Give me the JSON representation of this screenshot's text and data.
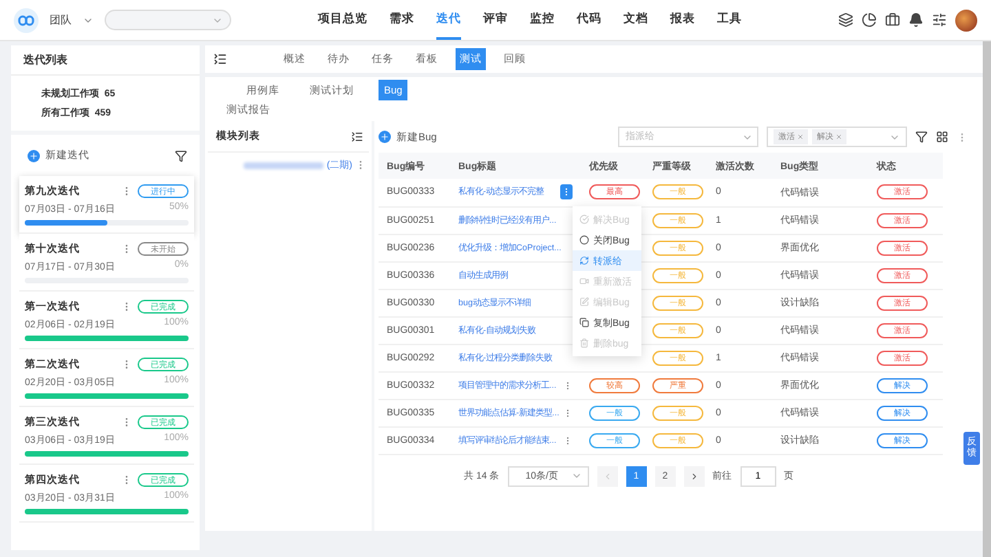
{
  "header": {
    "team": "团队",
    "nav": [
      {
        "label": "项目总览",
        "selected": false
      },
      {
        "label": "需求",
        "selected": false
      },
      {
        "label": "迭代",
        "selected": true
      },
      {
        "label": "评审",
        "selected": false
      },
      {
        "label": "监控",
        "selected": false
      },
      {
        "label": "代码",
        "selected": false
      },
      {
        "label": "文档",
        "selected": false
      },
      {
        "label": "报表",
        "selected": false
      },
      {
        "label": "工具",
        "selected": false
      }
    ]
  },
  "sidebar": {
    "title": "迭代列表",
    "stats": [
      {
        "label": "未规划工作项",
        "count": "65"
      },
      {
        "label": "所有工作项",
        "count": "459"
      }
    ],
    "new_button": "新建迭代",
    "iterations": [
      {
        "name": "第九次迭代",
        "dates": "07月03日 - 07月16日",
        "percent": "50%",
        "level": 0.5,
        "status": "进行中",
        "color": "#2f9bf0",
        "selected": true
      },
      {
        "name": "第十次迭代",
        "dates": "07月17日 - 07月30日",
        "percent": "0%",
        "level": 0,
        "status": "未开始",
        "color": "#888888",
        "selected": false
      },
      {
        "name": "第一次迭代",
        "dates": "02月06日 - 02月19日",
        "percent": "100%",
        "level": 1,
        "status": "已完成",
        "color": "#19c88a",
        "selected": false
      },
      {
        "name": "第二次迭代",
        "dates": "02月20日 - 03月05日",
        "percent": "100%",
        "level": 1,
        "status": "已完成",
        "color": "#19c88a",
        "selected": false
      },
      {
        "name": "第三次迭代",
        "dates": "03月06日 - 03月19日",
        "percent": "100%",
        "level": 1,
        "status": "已完成",
        "color": "#19c88a",
        "selected": false
      },
      {
        "name": "第四次迭代",
        "dates": "03月20日 - 03月31日",
        "percent": "100%",
        "level": 1,
        "status": "已完成",
        "color": "#19c88a",
        "selected": false
      }
    ]
  },
  "view_tabs": [
    {
      "label": "概述",
      "selected": false
    },
    {
      "label": "待办",
      "selected": false
    },
    {
      "label": "任务",
      "selected": false
    },
    {
      "label": "看板",
      "selected": false
    },
    {
      "label": "测试",
      "selected": true
    },
    {
      "label": "回顾",
      "selected": false
    }
  ],
  "test_tabs": [
    {
      "label": "用例库",
      "selected": false
    },
    {
      "label": "测试计划",
      "selected": false
    },
    {
      "label": "Bug",
      "selected": true
    },
    {
      "label": "测试报告",
      "selected": false
    }
  ],
  "modules": {
    "title": "模块列表",
    "items": [
      "(二期)"
    ]
  },
  "toolbar": {
    "new_button": "新建Bug",
    "assignee": {
      "placeholder": "指派给"
    },
    "status_filter": [
      "激活",
      "解决"
    ]
  },
  "table": {
    "columns": [
      "Bug编号",
      "Bug标题",
      "优先级",
      "严重等级",
      "激活次数",
      "Bug类型",
      "状态"
    ],
    "rows": [
      {
        "id": "BUG00333",
        "title": "私有化-动态显示不完整",
        "priority": {
          "text": "最高",
          "color": "#f05a5a"
        },
        "severity": {
          "text": "一般",
          "color": "#f5b83d"
        },
        "count": "0",
        "type": "代码错误",
        "status": {
          "text": "激活",
          "color": "#f05a5a"
        }
      },
      {
        "id": "BUG00251",
        "title": "删除特性时已经没有用户...",
        "severity": {
          "text": "一般",
          "color": "#f5b83d"
        },
        "count": "1",
        "type": "代码错误",
        "status": {
          "text": "激活",
          "color": "#f05a5a"
        }
      },
      {
        "id": "BUG00236",
        "title": "优化升级：增加CoProject...",
        "severity": {
          "text": "一般",
          "color": "#f5b83d"
        },
        "count": "0",
        "type": "界面优化",
        "status": {
          "text": "激活",
          "color": "#f05a5a"
        }
      },
      {
        "id": "BUG00336",
        "title": "自动生成用例",
        "severity": {
          "text": "一般",
          "color": "#f5b83d"
        },
        "count": "0",
        "type": "代码错误",
        "status": {
          "text": "激活",
          "color": "#f05a5a"
        }
      },
      {
        "id": "BUG00330",
        "title": "bug动态显示不详细",
        "severity": {
          "text": "一般",
          "color": "#f5b83d"
        },
        "count": "0",
        "type": "设计缺陷",
        "status": {
          "text": "激活",
          "color": "#f05a5a"
        }
      },
      {
        "id": "BUG00301",
        "title": "私有化-自动规划失败",
        "severity": {
          "text": "一般",
          "color": "#f5b83d"
        },
        "count": "0",
        "type": "代码错误",
        "status": {
          "text": "激活",
          "color": "#f05a5a"
        }
      },
      {
        "id": "BUG00292",
        "title": "私有化-过程分类删除失败",
        "severity": {
          "text": "一般",
          "color": "#f5b83d"
        },
        "count": "1",
        "type": "代码错误",
        "status": {
          "text": "激活",
          "color": "#f05a5a"
        }
      },
      {
        "id": "BUG00332",
        "title": "项目管理中的需求分析工...",
        "priority": {
          "text": "较高",
          "color": "#f07a3c"
        },
        "severity": {
          "text": "严重",
          "color": "#f07a3c"
        },
        "count": "0",
        "type": "界面优化",
        "status": {
          "text": "解决",
          "color": "#2f8df0"
        }
      },
      {
        "id": "BUG00335",
        "title": "世界功能点估算-新建类型...",
        "priority": {
          "text": "一般",
          "color": "#39a9f0"
        },
        "severity": {
          "text": "一般",
          "color": "#f5b83d"
        },
        "count": "0",
        "type": "代码错误",
        "status": {
          "text": "解决",
          "color": "#2f8df0"
        }
      },
      {
        "id": "BUG00334",
        "title": "填写评审结论后才能结束...",
        "priority": {
          "text": "一般",
          "color": "#39a9f0"
        },
        "severity": {
          "text": "一般",
          "color": "#f5b83d"
        },
        "count": "0",
        "type": "设计缺陷",
        "status": {
          "text": "解决",
          "color": "#2f8df0"
        }
      }
    ]
  },
  "row_menu": [
    {
      "label": "解决Bug",
      "disabled": true,
      "selected": false
    },
    {
      "label": "关闭Bug",
      "disabled": false,
      "selected": false
    },
    {
      "label": "转派给",
      "disabled": false,
      "selected": true
    },
    {
      "label": "重新激活",
      "disabled": true,
      "selected": false
    },
    {
      "label": "编辑Bug",
      "disabled": true,
      "selected": false
    },
    {
      "label": "复制Bug",
      "disabled": false,
      "selected": false
    },
    {
      "label": "删除bug",
      "disabled": true,
      "selected": false
    }
  ],
  "pagination": {
    "total": "共 14 条",
    "page_size": "10条/页",
    "pages": [
      {
        "label": "1",
        "selected": true
      },
      {
        "label": "2",
        "selected": false
      }
    ],
    "goto_label": "前往",
    "goto_value": "1",
    "goto_suffix": "页"
  },
  "feedback": "反馈"
}
